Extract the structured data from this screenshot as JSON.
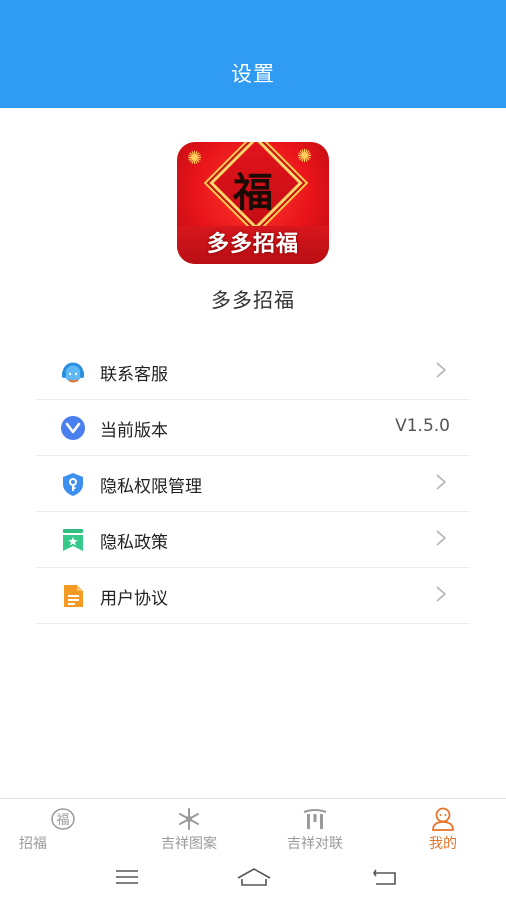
{
  "header": {
    "title": "设置"
  },
  "app": {
    "logo_text": "多多招福",
    "logo_char": "福",
    "name": "多多招福"
  },
  "menu": {
    "items": [
      {
        "label": "联系客服",
        "icon": "headset-icon"
      },
      {
        "label": "当前版本",
        "icon": "version-icon",
        "value": "V1.5.0"
      },
      {
        "label": "隐私权限管理",
        "icon": "shield-key-icon"
      },
      {
        "label": "隐私政策",
        "icon": "bookmark-star-icon"
      },
      {
        "label": "用户协议",
        "icon": "document-icon"
      }
    ]
  },
  "tabbar": {
    "tabs": [
      {
        "label": "招福",
        "icon": "fu-circle-icon"
      },
      {
        "label": "吉祥图案",
        "icon": "snowflake-icon"
      },
      {
        "label": "吉祥对联",
        "icon": "gate-icon"
      },
      {
        "label": "我的",
        "icon": "profile-icon",
        "active": true
      }
    ]
  },
  "colors": {
    "header_bg": "#2f9bf3",
    "active_tab": "#e8742a",
    "inactive_tab": "#9a9a9a"
  }
}
